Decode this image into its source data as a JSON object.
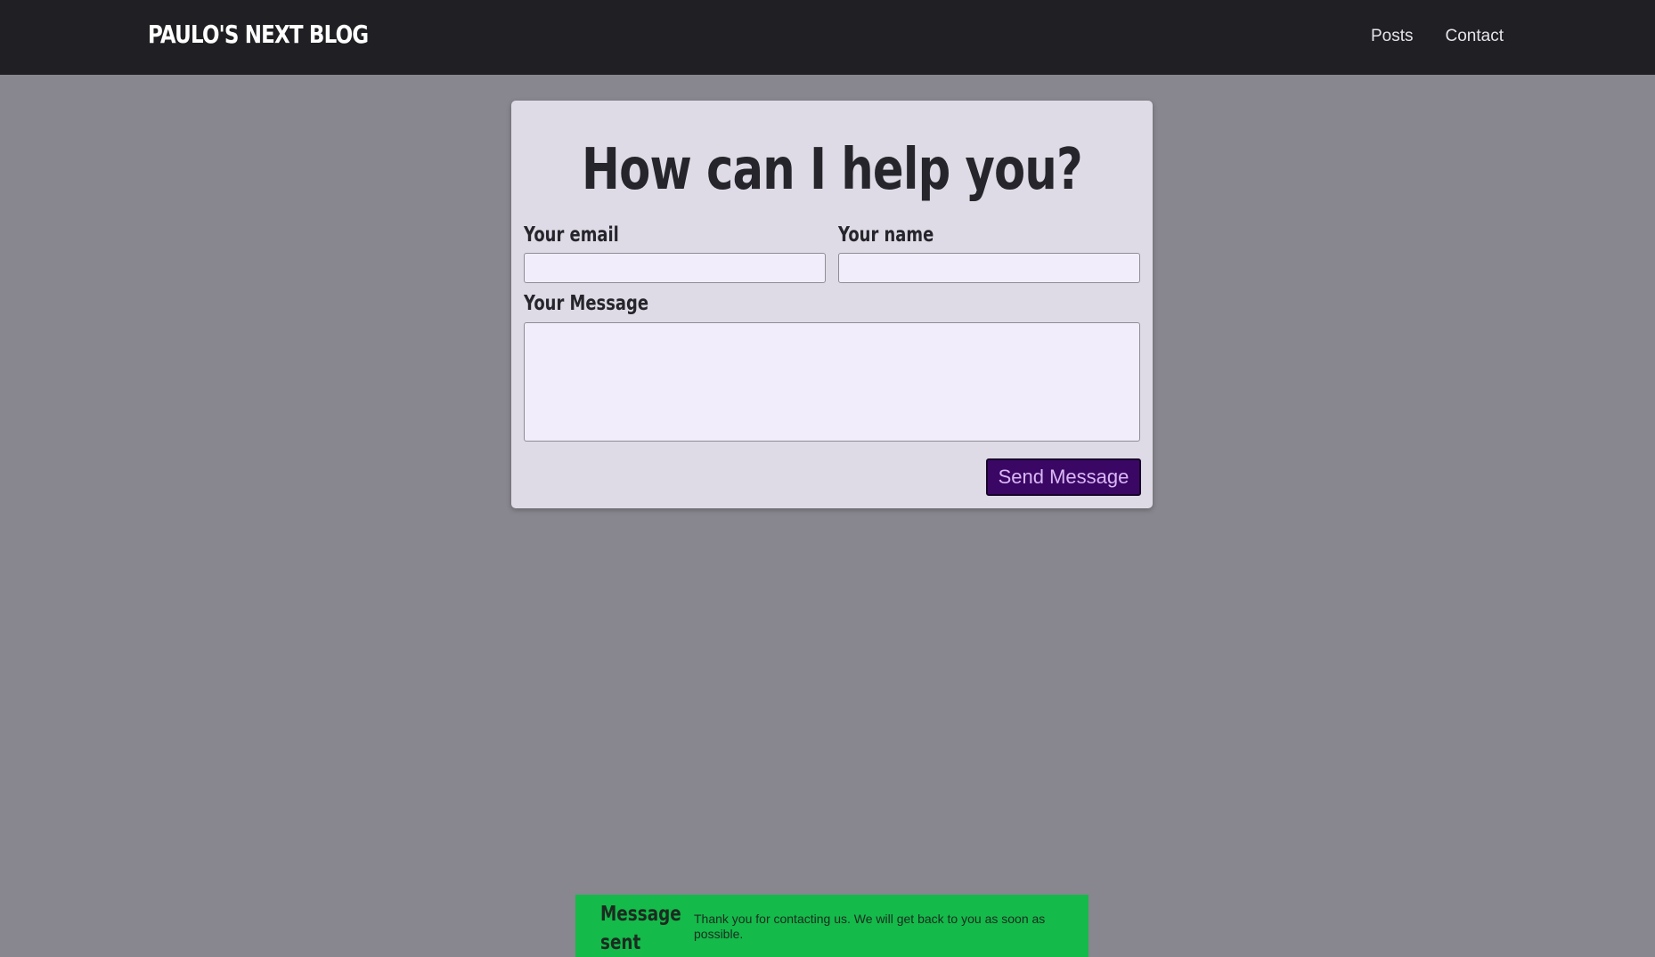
{
  "header": {
    "logo": "PAULO'S NEXT BLOG",
    "nav": [
      "Posts",
      "Contact"
    ]
  },
  "contact_form": {
    "title": "How can I help you?",
    "email_label": "Your email",
    "email_value": "",
    "name_label": "Your name",
    "name_value": "",
    "message_label": "Your Message",
    "message_value": "",
    "submit_label": "Send Message"
  },
  "notification": {
    "title": "Message sent",
    "message": "Thank you for contacting us. We will get back to you as soon as possible.",
    "color": "#14ba4a"
  },
  "colors": {
    "header_bg": "#201f23",
    "page_bg": "#88868e",
    "card_bg": "#dedbe6",
    "button_bg": "#3b0764",
    "button_text": "#d9b8f5"
  }
}
